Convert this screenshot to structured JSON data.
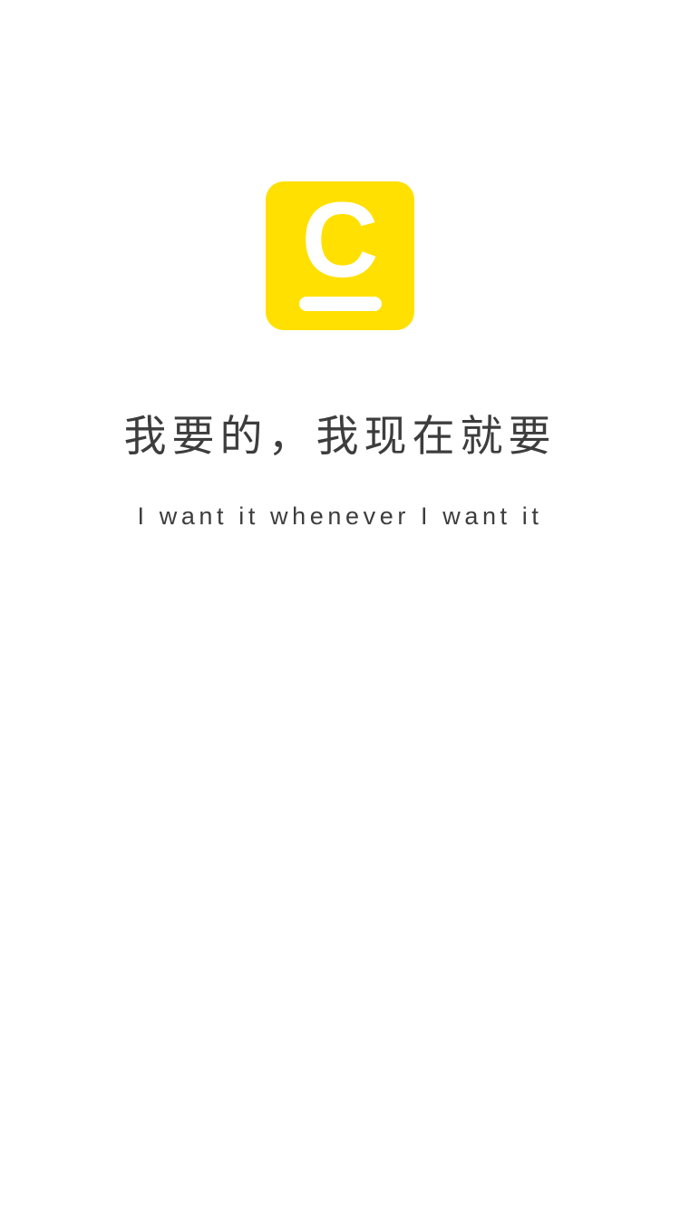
{
  "logo": {
    "letter": "C",
    "color": "#FFE000",
    "icon": "brand-logo-icon"
  },
  "slogan": {
    "chinese": "我要的，我现在就要",
    "english": "I want it whenever I want it"
  },
  "colors": {
    "text": "#3d3d3d",
    "background": "#ffffff"
  }
}
